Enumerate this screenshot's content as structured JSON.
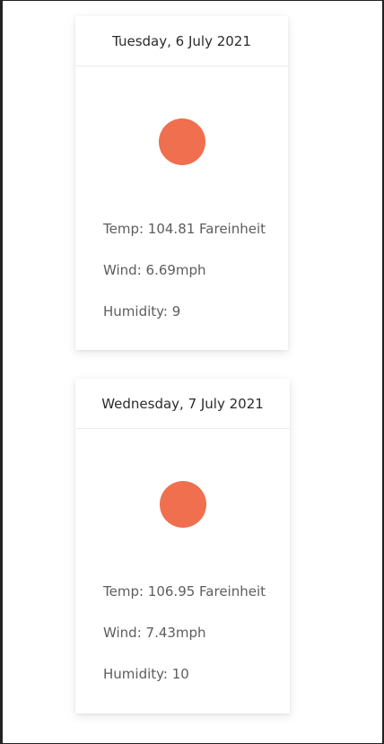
{
  "forecast": [
    {
      "date": "Tuesday, 6 July 2021",
      "icon": "sun-icon",
      "icon_color": "#ef6f4f",
      "temp": "Temp: 104.81 Fareinheit",
      "wind": "Wind: 6.69mph",
      "humidity": "Humidity: 9"
    },
    {
      "date": "Wednesday, 7 July 2021",
      "icon": "sun-icon",
      "icon_color": "#ef6f4f",
      "temp": "Temp: 106.95 Fareinheit",
      "wind": "Wind: 7.43mph",
      "humidity": "Humidity: 10"
    }
  ]
}
